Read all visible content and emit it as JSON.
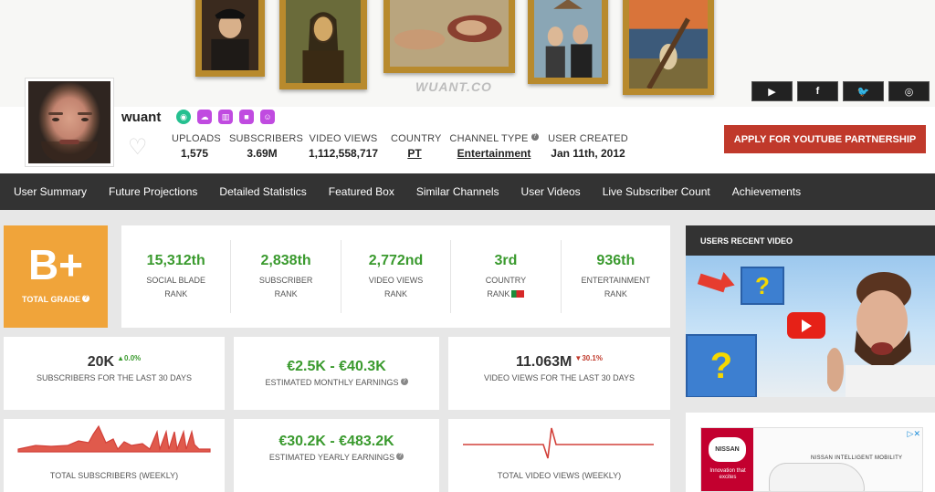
{
  "banner": {
    "watermark": "WUANT.CO"
  },
  "social": [
    {
      "icon": "youtube-icon",
      "glyph": "▶"
    },
    {
      "icon": "facebook-icon",
      "glyph": "f"
    },
    {
      "icon": "twitter-icon",
      "glyph": "🐦"
    },
    {
      "icon": "instagram-icon",
      "glyph": "◎"
    }
  ],
  "profile": {
    "username": "wuant",
    "badges": [
      {
        "icon": "target-icon",
        "color": "#25c090",
        "glyph": "◉"
      },
      {
        "icon": "cloud-icon",
        "color": "#c04be0",
        "glyph": "☁"
      },
      {
        "icon": "chart-icon",
        "color": "#c04be0",
        "glyph": "▥"
      },
      {
        "icon": "video-camera-icon",
        "color": "#c04be0",
        "glyph": "■"
      },
      {
        "icon": "group-icon",
        "color": "#c04be0",
        "glyph": "☺"
      }
    ]
  },
  "stats": {
    "uploads": {
      "label": "UPLOADS",
      "value": "1,575"
    },
    "subscribers": {
      "label": "SUBSCRIBERS",
      "value": "3.69M"
    },
    "video_views": {
      "label": "VIDEO VIEWS",
      "value": "1,112,558,717"
    },
    "country": {
      "label": "COUNTRY",
      "value": "PT"
    },
    "channel_type": {
      "label": "CHANNEL TYPE",
      "value": "Entertainment"
    },
    "user_created": {
      "label": "USER CREATED",
      "value": "Jan 11th, 2012"
    }
  },
  "partner_button": "APPLY FOR YOUTUBE PARTNERSHIP",
  "nav": [
    "User Summary",
    "Future Projections",
    "Detailed Statistics",
    "Featured Box",
    "Similar Channels",
    "User Videos",
    "Live Subscriber Count",
    "Achievements"
  ],
  "grade": {
    "value": "B+",
    "label": "TOTAL GRADE"
  },
  "ranks": [
    {
      "value": "15,312th",
      "line1": "SOCIAL BLADE",
      "line2": "RANK"
    },
    {
      "value": "2,838th",
      "line1": "SUBSCRIBER",
      "line2": "RANK"
    },
    {
      "value": "2,772nd",
      "line1": "VIDEO VIEWS",
      "line2": "RANK"
    },
    {
      "value": "3rd",
      "line1": "COUNTRY",
      "line2": "RANK"
    },
    {
      "value": "936th",
      "line1": "ENTERTAINMENT",
      "line2": "RANK"
    }
  ],
  "summary": {
    "subs30": {
      "value": "20K",
      "change": "0.0%",
      "label": "SUBSCRIBERS FOR THE LAST 30 DAYS"
    },
    "monthly": {
      "value": "€2.5K - €40.3K",
      "label": "ESTIMATED MONTHLY EARNINGS"
    },
    "views30": {
      "value": "11.063M",
      "change": "30.1%",
      "label": "VIDEO VIEWS FOR THE LAST 30 DAYS"
    },
    "yearly": {
      "value": "€30.2K - €483.2K",
      "label": "ESTIMATED YEARLY EARNINGS"
    },
    "subs_weekly_label": "TOTAL SUBSCRIBERS (WEEKLY)",
    "views_weekly_label": "TOTAL VIDEO VIEWS (WEEKLY)"
  },
  "colors": {
    "accent_red": "#c0392b",
    "green": "#3a9a2e",
    "grade_orange": "#f0a43a",
    "nav_bg": "#333333"
  },
  "sidebar": {
    "video_title": "USERS RECENT VIDEO",
    "ad_brand": "NISSAN",
    "ad_tagline": "Innovation that excites",
    "ad_text": "NISSAN INTELLIGENT MOBILITY"
  }
}
